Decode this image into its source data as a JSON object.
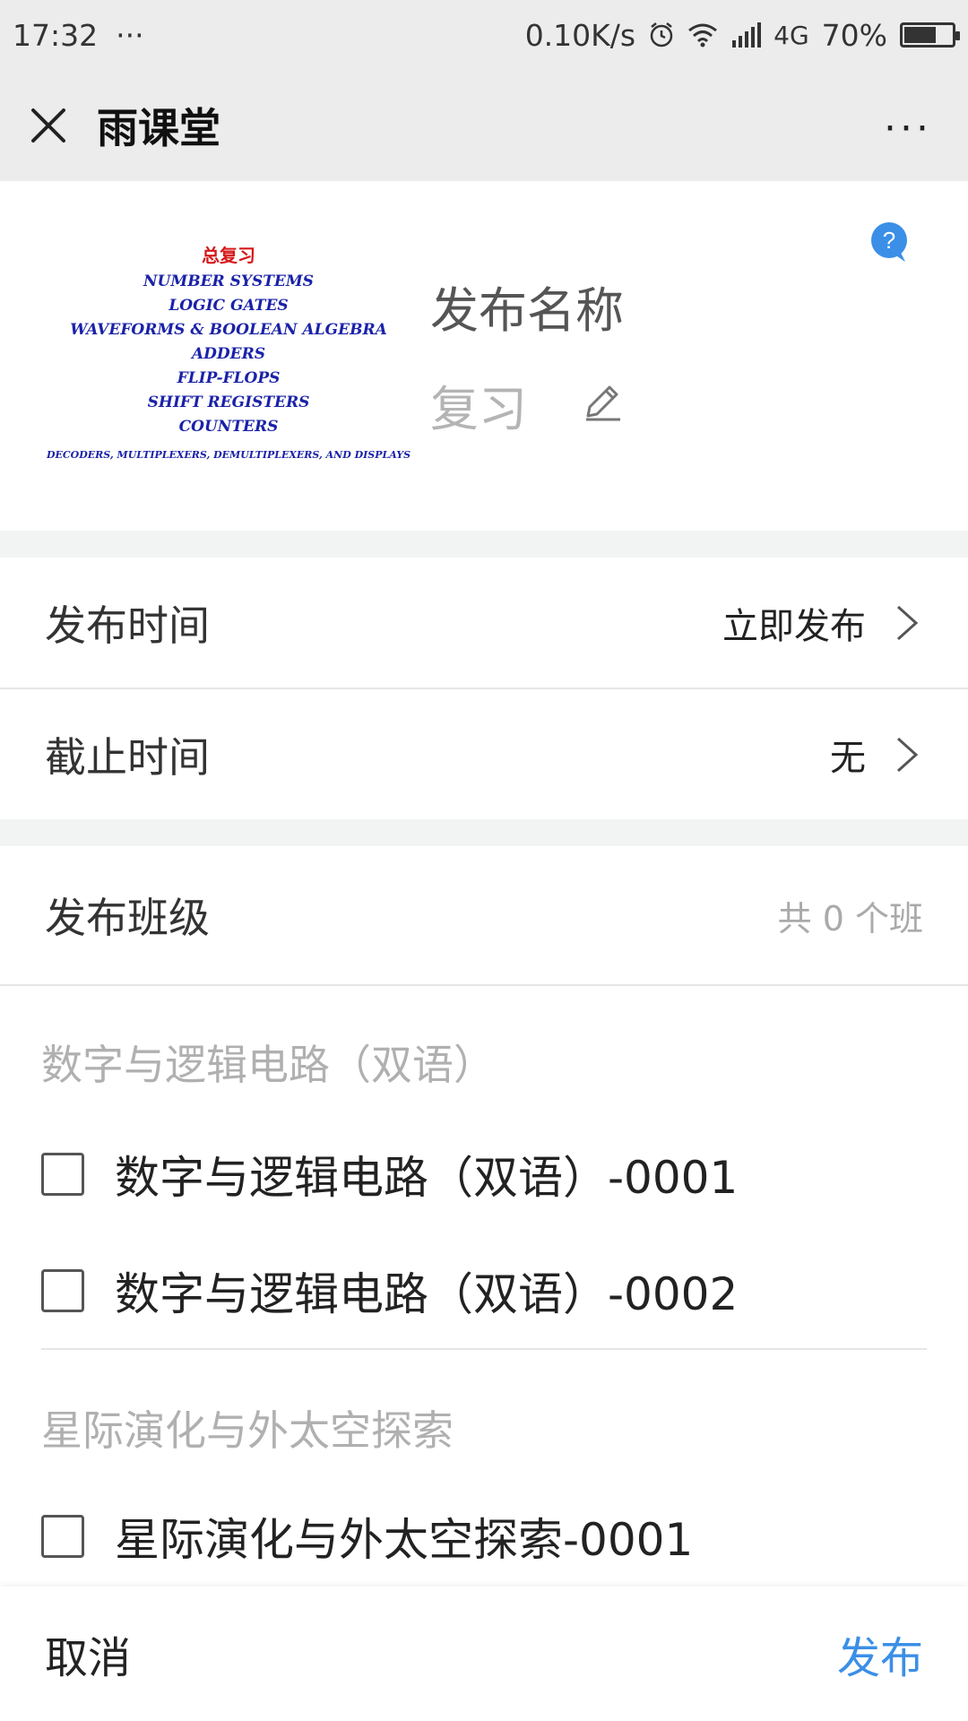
{
  "status_bar": {
    "time": "17:32",
    "dots": "···",
    "network_speed": "0.10K/s",
    "network_type": "4G",
    "battery": "70%",
    "battery_level": 0.7
  },
  "app_bar": {
    "title": "雨课堂",
    "more": "···"
  },
  "cover": {
    "title": "总复习",
    "lines": [
      "NUMBER SYSTEMS",
      "LOGIC GATES",
      "WAVEFORMS & BOOLEAN ALGEBRA",
      "ADDERS",
      "FLIP-FLOPS",
      "SHIFT REGISTERS",
      "COUNTERS"
    ],
    "last_line": "DECODERS, MULTIPLEXERS, DEMULTIPLEXERS, AND DISPLAYS"
  },
  "publish_name": {
    "label": "发布名称",
    "value": "复习"
  },
  "publish_time": {
    "label": "发布时间",
    "value": "立即发布"
  },
  "deadline": {
    "label": "截止时间",
    "value": "无"
  },
  "classes": {
    "label": "发布班级",
    "count": "共 0 个班",
    "groups": [
      {
        "title": "数字与逻辑电路（双语）",
        "items": [
          "数字与逻辑电路（双语）-0001",
          "数字与逻辑电路（双语）-0002"
        ]
      },
      {
        "title": "星际演化与外太空探索",
        "items": [
          "星际演化与外太空探索-0001"
        ]
      }
    ]
  },
  "footer": {
    "cancel": "取消",
    "publish": "发布"
  },
  "colors": {
    "accent": "#3b8fe6",
    "cover_title": "#d6191b",
    "cover_text": "#1a22a8"
  }
}
